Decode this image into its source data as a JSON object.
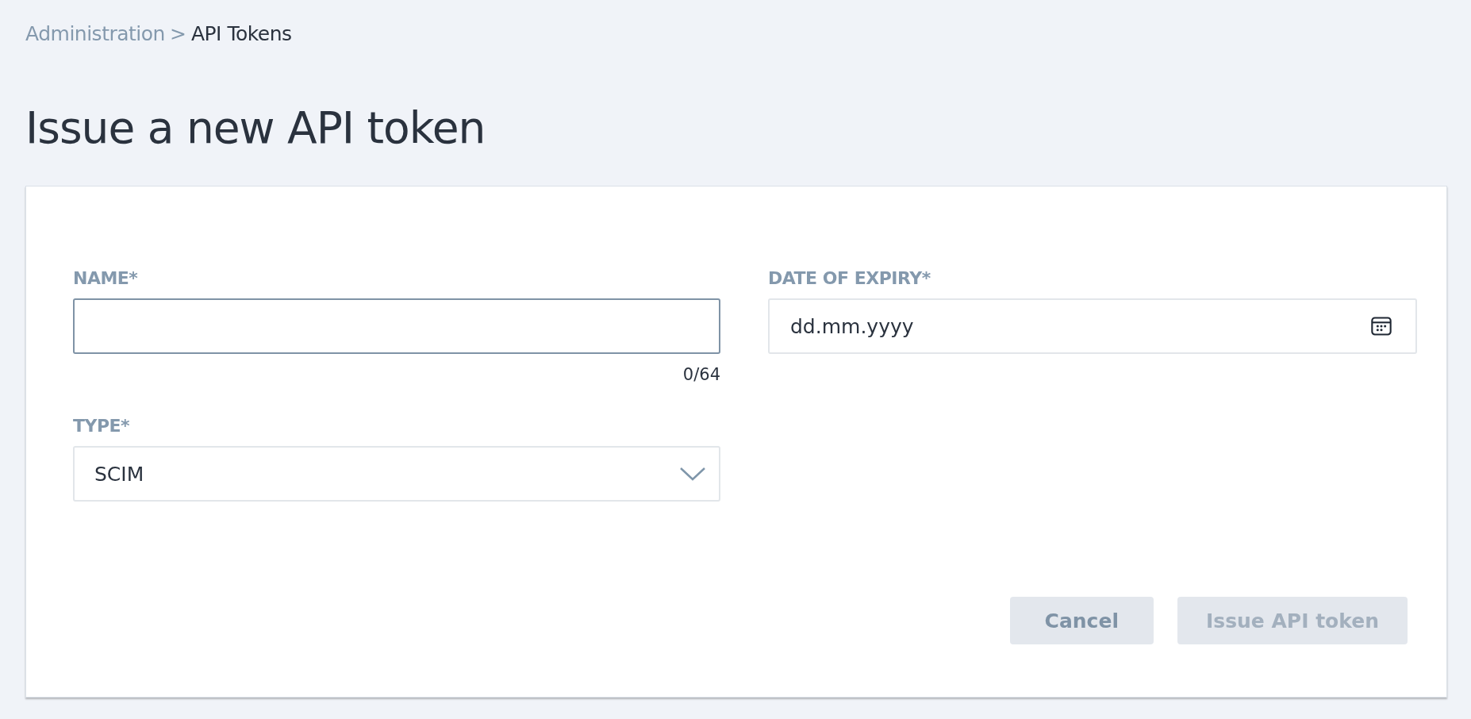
{
  "breadcrumb": [
    {
      "label": "Administration",
      "kind": "link"
    },
    {
      "label": ">",
      "kind": "separator"
    },
    {
      "label": "API Tokens",
      "kind": "current"
    }
  ],
  "title": "Issue a new API token",
  "form": {
    "name": {
      "label": "NAME*",
      "focused": true,
      "counter": "0/64"
    },
    "type": {
      "label": "TYPE*",
      "value": "SCIM"
    },
    "expiry": {
      "label": "DATE OF EXPIRY*",
      "placeholder": "dd.mm.yyyy"
    }
  },
  "buttons": [
    {
      "label": "Cancel",
      "disabled": false
    },
    {
      "label": "Issue API token",
      "disabled": true
    }
  ]
}
